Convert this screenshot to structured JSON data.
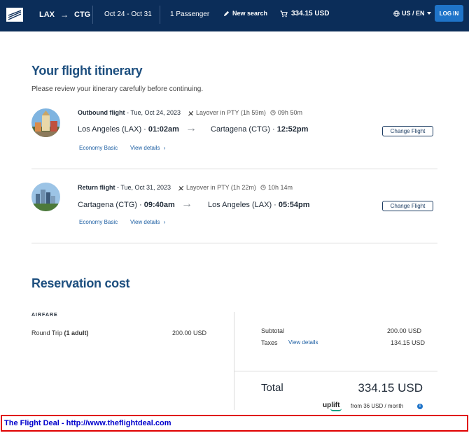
{
  "header": {
    "origin": "LAX",
    "arrow": "→",
    "destination": "CTG",
    "dates": "Oct 24 - Oct 31",
    "passengers": "1 Passenger",
    "new_search": "New search",
    "cart_total": "334.15 USD",
    "locale": "US / EN",
    "login": "LOG IN"
  },
  "itinerary": {
    "title": "Your flight itinerary",
    "subtitle": "Please review your itinerary carefully before continuing.",
    "flights": [
      {
        "label": "Outbound flight",
        "date": " - Tue, Oct 24, 2023",
        "layover": "Layover in PTY (1h 59m)",
        "duration": "09h 50m",
        "from_city": "Los Angeles (LAX) · ",
        "from_time": "01:02am",
        "to_city": "Cartagena (CTG) · ",
        "to_time": "12:52pm",
        "fare": "Economy Basic",
        "details": "View details",
        "change": "Change Flight"
      },
      {
        "label": "Return flight",
        "date": " - Tue, Oct 31, 2023",
        "layover": "Layover in PTY (1h 22m)",
        "duration": "10h 14m",
        "from_city": "Cartagena (CTG) · ",
        "from_time": "09:40am",
        "to_city": "Los Angeles (LAX) · ",
        "to_time": "05:54pm",
        "fare": "Economy Basic",
        "details": "View details",
        "change": "Change Flight"
      }
    ]
  },
  "reservation": {
    "title": "Reservation cost",
    "airfare_label": "AIRFARE",
    "trip_label": "Round Trip ",
    "trip_pax": "(1 adult)",
    "trip_price": "200.00 USD",
    "subtotal_label": "Subtotal",
    "subtotal_value": "200.00 USD",
    "taxes_label": "Taxes",
    "taxes_link": "View details",
    "taxes_value": "134.15 USD",
    "total_label": "Total",
    "total_value": "334.15 USD",
    "uplift_brand": "uplift",
    "uplift_text": "from 36 USD  / month",
    "info": "i"
  },
  "banner": {
    "text": "The Flight Deal - http://www.theflightdeal.com"
  },
  "colors": {
    "header_bg": "#0b2d59",
    "accent": "#1d4f7f",
    "link": "#1d5fa3",
    "login_btn": "#1f74c9",
    "banner_border": "#e00000",
    "banner_text": "#0000cc"
  },
  "icons": [
    "logo-icon",
    "arrow-right-icon",
    "pencil-icon",
    "cart-icon",
    "globe-icon",
    "chevron-down-icon",
    "plane-icon",
    "clock-icon",
    "chevron-right-icon",
    "info-icon"
  ]
}
